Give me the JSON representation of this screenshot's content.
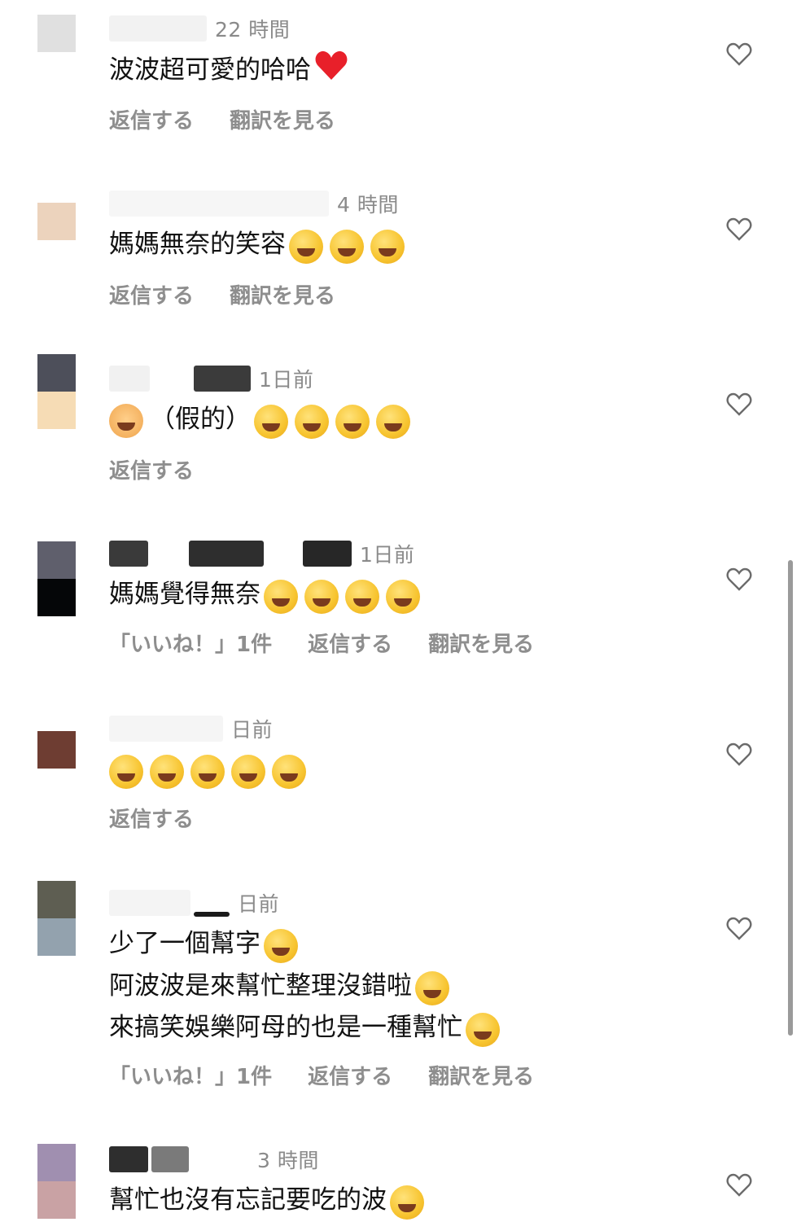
{
  "comments": [
    {
      "avatar": [
        "#e0e0e0",
        "#ffffff"
      ],
      "blurred_name": [
        "#f2f2f2",
        "#efefef"
      ],
      "time": "22 時間",
      "lines": [
        "波波超可愛的哈哈"
      ],
      "emoji_icons": [
        "red-heart-icon"
      ],
      "actions": [
        "返信する",
        "翻訳を見る"
      ]
    },
    {
      "avatar": [
        "#ecd3bd",
        "#fbf6f4"
      ],
      "blurred_name": [
        "#f6f6f6",
        "#f3f3f3"
      ],
      "time": "4 時間",
      "lines": [
        "媽媽無奈的笑容"
      ],
      "emoji_icons": [
        "grinning-sweat-icon",
        "grinning-sweat-icon",
        "grinning-sweat-icon"
      ],
      "actions": [
        "返信する",
        "翻訳を見る"
      ]
    },
    {
      "avatar": [
        "#4d4f5a",
        "#f6dcb5"
      ],
      "blurred_name": [
        "#f1f1f1",
        "#3b3b3b"
      ],
      "time": "1日前",
      "lines": [
        "（假的）"
      ],
      "emoji_icons": [
        "tears-of-joy-icon",
        "tears-of-joy-icon",
        "tears-of-joy-icon",
        "tears-of-joy-icon"
      ],
      "actions": [
        "返信する"
      ]
    },
    {
      "avatar": [
        "#5f5f6c",
        "#050608"
      ],
      "blurred_name": [
        "#3a3a3a",
        "#2e2e2e",
        "#272727"
      ],
      "time": "1日前",
      "lines": [
        "媽媽覺得無奈"
      ],
      "emoji_icons": [
        "tears-of-joy-icon",
        "tears-of-joy-icon",
        "tears-of-joy-icon",
        "tears-of-joy-icon"
      ],
      "actions": [
        "「いいね！」1件",
        "返信する",
        "翻訳を見る"
      ]
    },
    {
      "avatar": [
        "#6e3d32",
        "#6e3d32"
      ],
      "blurred_name": [
        "#f5f5f5"
      ],
      "time": "日前",
      "lines": [
        ""
      ],
      "emoji_icons": [
        "tears-of-joy-icon",
        "tears-of-joy-icon",
        "tears-of-joy-icon",
        "tears-of-joy-icon",
        "tears-of-joy-icon"
      ],
      "actions": [
        "返信する"
      ]
    },
    {
      "avatar": [
        "#5e5e52",
        "#93a2ae"
      ],
      "blurred_name": [
        "#f4f4f4",
        "#1a1a1a"
      ],
      "time": "日前",
      "lines": [
        "少了一個幫字",
        "阿波波是來幫忙整理沒錯啦",
        "來搞笑娛樂阿母的也是一種幫忙"
      ],
      "emoji_icons": [
        "laughing-squint-icon",
        "beaming-grin-icon",
        "laughing-squint-icon"
      ],
      "actions": [
        "「いいね！」1件",
        "返信する",
        "翻訳を見る"
      ]
    },
    {
      "avatar": [
        "#a08fb0",
        "#c9a2a4"
      ],
      "blurred_name": [
        "#2e2e2e",
        "#7a7a7a"
      ],
      "time": "3 時間",
      "lines": [
        "幫忙也沒有忘記要吃的波"
      ],
      "emoji_icons": [
        "tears-of-joy-icon"
      ],
      "actions": []
    }
  ],
  "colors": {
    "text": "#121212",
    "meta": "#8a8a8a",
    "action": "#8e8e8e",
    "heart_outline": "#6b6b6b",
    "scrollbar": "#9a9a9a"
  }
}
